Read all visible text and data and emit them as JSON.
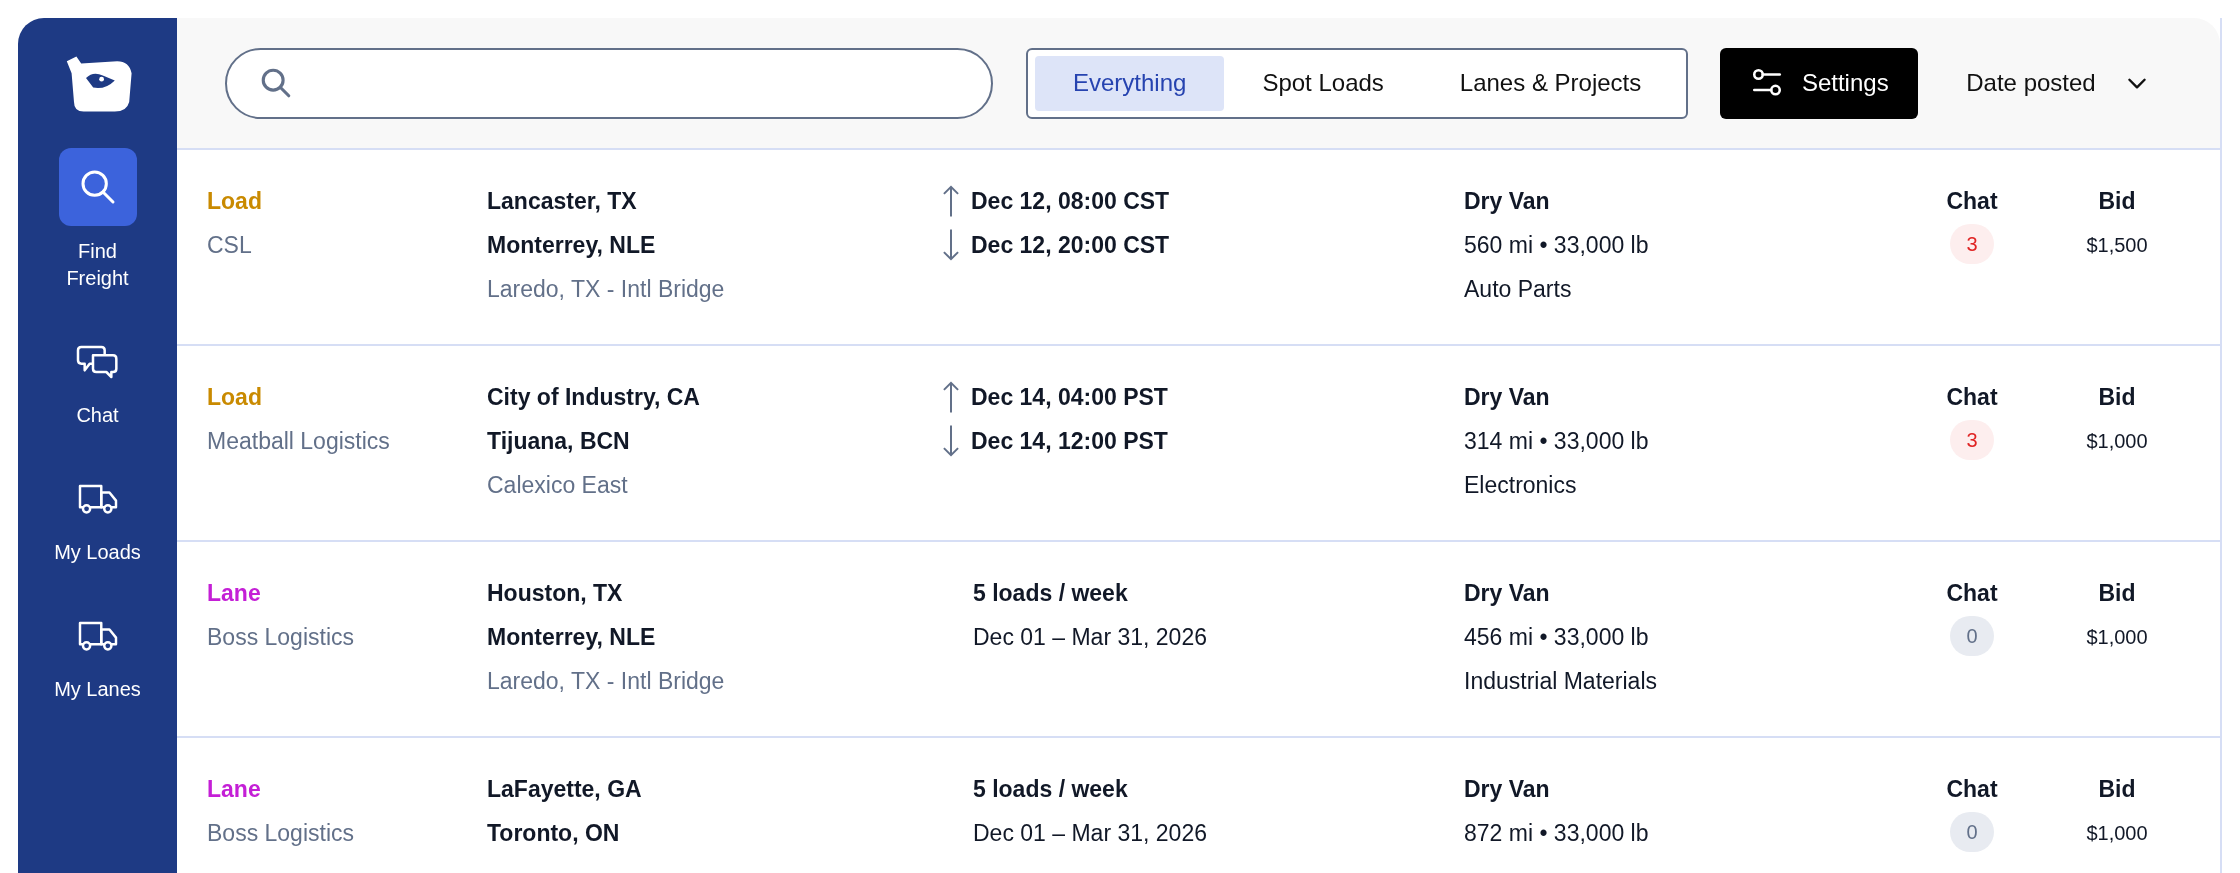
{
  "sidebar": {
    "items": [
      {
        "kind": "search",
        "label": "Find Freight",
        "selected": true
      },
      {
        "kind": "chat",
        "label": "Chat",
        "selected": false
      },
      {
        "kind": "truck",
        "label": "My Loads",
        "selected": false
      },
      {
        "kind": "truck",
        "label": "My Lanes",
        "selected": false
      }
    ]
  },
  "toolbar": {
    "tabs": [
      {
        "label": "Everything",
        "selected": true
      },
      {
        "label": "Spot Loads",
        "selected": false
      },
      {
        "label": "Lanes & Projects",
        "selected": false
      }
    ],
    "settings_button": "Settings",
    "sort": "Date posted"
  },
  "rows": [
    {
      "kind": "load",
      "type": "Load",
      "color": "#c98a00",
      "company": "CSL",
      "origin": "Lancaster, TX",
      "destination": "Monterrey, NLE",
      "crossing": "Laredo, TX - Intl Bridge",
      "pickup": "Dec 12, 08:00 CST",
      "delivery": "Dec 12, 20:00 CST",
      "equipment": "Dry Van",
      "distance_weight": "560 mi • 33,000 lb",
      "commodity": "Auto Parts",
      "chat_label": "Chat",
      "chat_count": "3",
      "unread": true,
      "bid_label": "Bid",
      "bid": "$1,500"
    },
    {
      "kind": "load",
      "type": "Load",
      "color": "#c98a00",
      "company": "Meatball Logistics",
      "origin": "City of Industry, CA",
      "destination": "Tijuana, BCN",
      "crossing": "Calexico East",
      "pickup": "Dec 14, 04:00 PST",
      "delivery": "Dec 14, 12:00 PST",
      "equipment": "Dry Van",
      "distance_weight": "314 mi • 33,000 lb",
      "commodity": "Electronics",
      "chat_label": "Chat",
      "chat_count": "3",
      "unread": true,
      "bid_label": "Bid",
      "bid": "$1,000"
    },
    {
      "kind": "lane",
      "type": "Lane",
      "color": "#c41fd6",
      "company": "Boss Logistics",
      "origin": "Houston, TX",
      "destination": "Monterrey, NLE",
      "crossing": "Laredo, TX - Intl Bridge",
      "frequency": "5 loads / week",
      "period": "Dec 01 – Mar 31, 2026",
      "equipment": "Dry Van",
      "distance_weight": "456 mi • 33,000 lb",
      "commodity": "Industrial Materials",
      "chat_label": "Chat",
      "chat_count": "0",
      "unread": false,
      "bid_label": "Bid",
      "bid": "$1,000"
    },
    {
      "kind": "lane",
      "type": "Lane",
      "color": "#c41fd6",
      "company": "Boss Logistics",
      "origin": "LaFayette, GA",
      "destination": "Toronto, ON",
      "frequency": "5 loads / week",
      "period": "Dec 01 – Mar 31, 2026",
      "equipment": "Dry Van",
      "distance_weight": "872 mi • 33,000 lb",
      "chat_label": "Chat",
      "chat_count": "0",
      "unread": false,
      "bid_label": "Bid",
      "bid": "$1,000"
    }
  ]
}
